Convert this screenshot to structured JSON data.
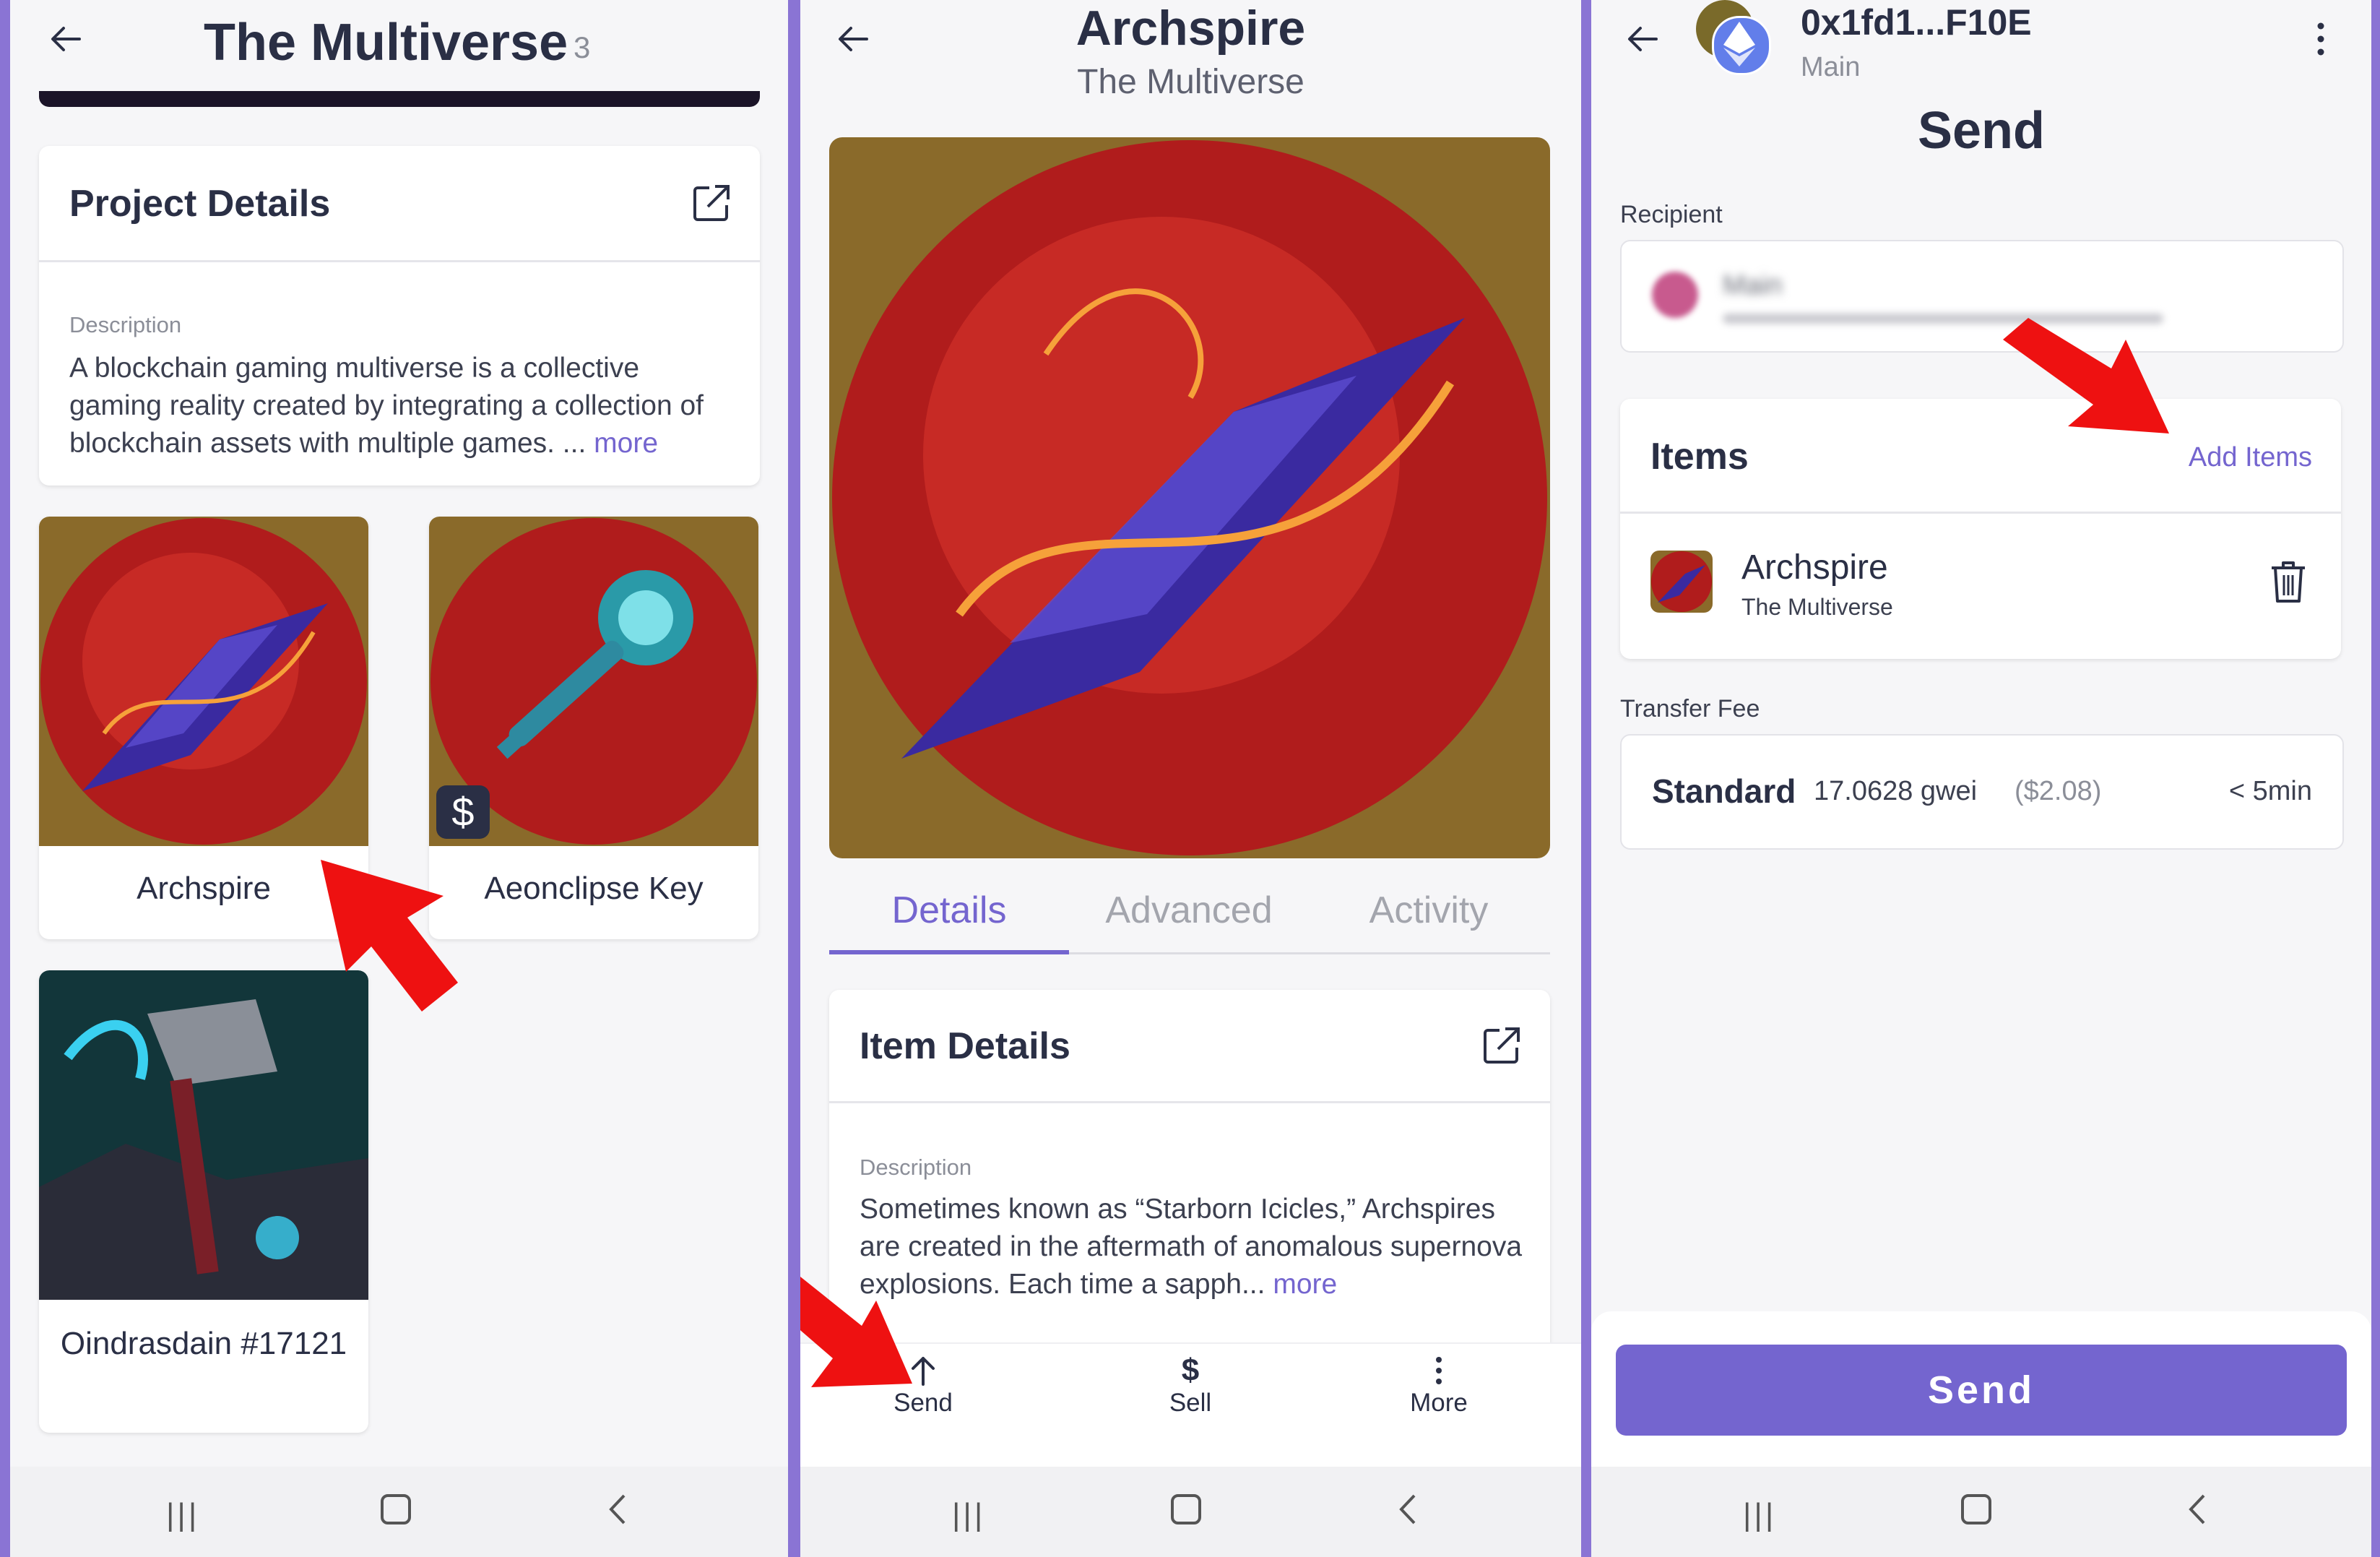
{
  "panel1": {
    "title": "The Multiverse",
    "count": "3",
    "project_card": {
      "heading": "Project Details",
      "desc_label": "Description",
      "desc_text": "A blockchain gaming multiverse is a collective gaming reality created by integrating a collection of blockchain assets with multiple games. ...",
      "more": "more"
    },
    "items": [
      {
        "name": "Archspire"
      },
      {
        "name": "Aeonclipse Key"
      },
      {
        "name": "Oindrasdain #17121"
      }
    ]
  },
  "panel2": {
    "title": "Archspire",
    "subtitle": "The Multiverse",
    "tabs": [
      "Details",
      "Advanced",
      "Activity"
    ],
    "details_card": {
      "heading": "Item Details",
      "desc_label": "Description",
      "desc_text": "Sometimes known as “Starborn Icicles,” Archspires are created in the aftermath of anomalous supernova explosions. Each time a sapph...",
      "more": "more"
    },
    "actions": [
      {
        "label": "Send",
        "icon": "arrow-up-icon"
      },
      {
        "label": "Sell",
        "icon": "dollar-icon"
      },
      {
        "label": "More",
        "icon": "dots-vertical-icon"
      }
    ]
  },
  "panel3": {
    "address": "0x1fd1...F10E",
    "account": "Main",
    "title": "Send",
    "recipient_label": "Recipient",
    "recipient_name": "Main",
    "items_heading": "Items",
    "add_items": "Add Items",
    "item": {
      "name": "Archspire",
      "collection": "The Multiverse"
    },
    "fee_label": "Transfer Fee",
    "fee": {
      "tier": "Standard",
      "gas": "17.0628 gwei",
      "usd": "($2.08)",
      "time": "< 5min"
    },
    "send_button": "Send"
  },
  "colors": {
    "accent": "#7465cf",
    "divider": "#8a74d4",
    "annotation": "#ee1111"
  }
}
